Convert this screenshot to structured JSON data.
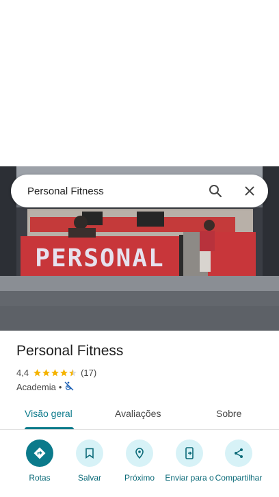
{
  "search": {
    "query": "Personal Fitness"
  },
  "photo": {
    "sign_text": "PERSONAL"
  },
  "place": {
    "name": "Personal Fitness",
    "rating": "4,4",
    "rating_value": 4.4,
    "reviews": "(17)",
    "category": "Academia",
    "separator": "•"
  },
  "tabs": [
    {
      "label": "Visão geral",
      "active": true
    },
    {
      "label": "Avaliações",
      "active": false
    },
    {
      "label": "Sobre",
      "active": false
    }
  ],
  "actions": [
    {
      "label": "Rotas",
      "icon": "directions-icon"
    },
    {
      "label": "Salvar",
      "icon": "bookmark-icon"
    },
    {
      "label": "Próximo",
      "icon": "nearby-icon"
    },
    {
      "label": "Enviar para o",
      "icon": "send-to-phone-icon"
    },
    {
      "label": "Compartilhar",
      "icon": "share-icon"
    }
  ],
  "colors": {
    "accent": "#0b7a8b",
    "star": "#f5b400",
    "action_bg": "#d7f2f7"
  }
}
